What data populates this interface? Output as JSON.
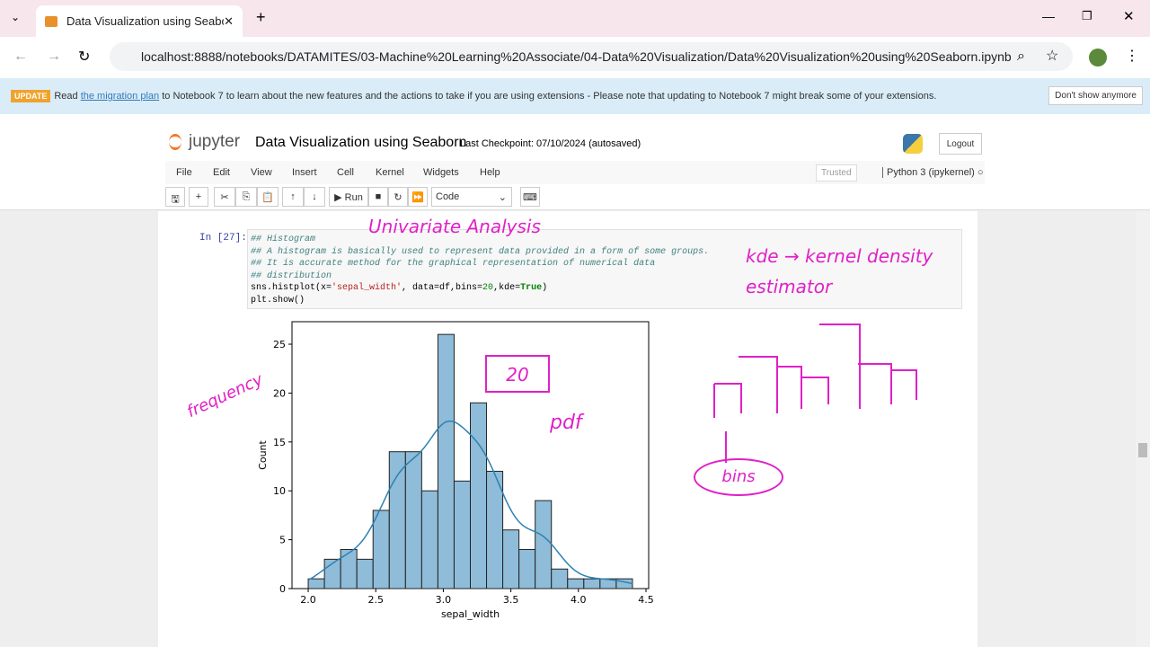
{
  "browser": {
    "tab_title": "Data Visualization using Seaborn",
    "url": "localhost:8888/notebooks/DATAMITES/03-Machine%20Learning%20Associate/04-Data%20Visualization/Data%20Visualization%20using%20Seaborn.ipynb"
  },
  "banner": {
    "badge": "UPDATE",
    "pre": "Read ",
    "link": "the migration plan",
    "post": " to Notebook 7 to learn about the new features and the actions to take if you are using extensions - Please note that updating to Notebook 7 might break some of your extensions.",
    "dismiss": "Don't show anymore"
  },
  "header": {
    "logo": "jupyter",
    "title": "Data Visualization using Seaborn",
    "checkpoint": "Last Checkpoint: 07/10/2024  (autosaved)",
    "logout": "Logout"
  },
  "menu": [
    "File",
    "Edit",
    "View",
    "Insert",
    "Cell",
    "Kernel",
    "Widgets",
    "Help"
  ],
  "trusted": "Trusted",
  "kernel": "Python 3 (ipykernel)",
  "toolbar": {
    "run": "Run",
    "cell_type": "Code"
  },
  "cell": {
    "prompt": "In [27]:",
    "lines": [
      "## Histogram",
      "## A histogram is basically used to represent data provided in a form of some groups.",
      "## It is accurate method for the graphical representation of numerical data",
      "## distribution"
    ],
    "code1a": "sns.histplot(x=",
    "code1b": "'sepal_width'",
    "code1c": ", data=df,bins=",
    "code1d": "20",
    "code1e": ",kde=",
    "code1f": "True",
    "code1g": ")",
    "code2": "plt.show()"
  },
  "annotations": {
    "univariate": "Univariate Analysis",
    "kde": "kde → kernel density estimator",
    "frequency": "frequency",
    "bins_box": "20",
    "pdf": "pdf",
    "bins": "bins"
  },
  "chart_data": {
    "type": "bar",
    "title": "",
    "xlabel": "sepal_width",
    "ylabel": "Count",
    "bin_start": 2.0,
    "bin_width": 0.12,
    "values": [
      1,
      3,
      4,
      3,
      8,
      14,
      14,
      10,
      26,
      11,
      19,
      12,
      6,
      4,
      9,
      2,
      1,
      1,
      1,
      1
    ],
    "xlim": [
      1.88,
      4.52
    ],
    "ylim": [
      0,
      27.3
    ],
    "xticks": [
      "2.0",
      "2.5",
      "3.0",
      "3.5",
      "4.0",
      "4.5"
    ],
    "yticks": [
      "0",
      "5",
      "10",
      "15",
      "20",
      "25"
    ],
    "kde": true,
    "bar_color": "#8fbcd8",
    "kde_color": "#2c82b0"
  }
}
